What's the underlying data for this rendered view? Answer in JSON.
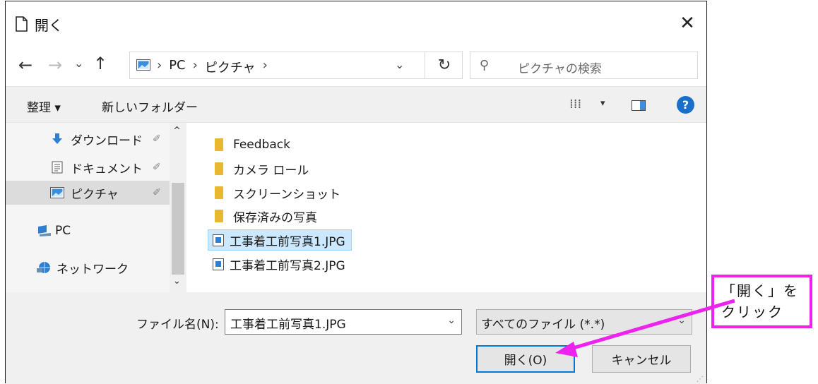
{
  "window": {
    "title": "開く",
    "close_glyph": "✕"
  },
  "navigation": {
    "back": "←",
    "forward": "→",
    "recent": "⌄",
    "up": "↑",
    "breadcrumb": [
      "PC",
      "ピクチャ"
    ],
    "separator": "›",
    "dropdown": "⌄",
    "refresh": "↻",
    "search_placeholder": "ピクチャの検索"
  },
  "toolbar": {
    "organize": "整理 ▾",
    "new_folder": "新しいフォルダー",
    "view": "⁞⁞⁞",
    "view_dropdown": "▾",
    "help": "?"
  },
  "sidebar": {
    "scroll_up": "^",
    "scroll_down": "⌄",
    "items": [
      {
        "label": "ダウンロード",
        "icon": "download-arrow-icon",
        "pinned": true
      },
      {
        "label": "ドキュメント",
        "icon": "document-icon",
        "pinned": true
      },
      {
        "label": "ピクチャ",
        "icon": "pictures-icon",
        "pinned": true,
        "selected": true
      },
      {
        "label": "PC",
        "icon": "computer-icon",
        "pinned": false
      },
      {
        "label": "ネットワーク",
        "icon": "network-icon",
        "pinned": false
      }
    ],
    "pin_glyph": "📌"
  },
  "files": [
    {
      "name": "Feedback",
      "type": "folder"
    },
    {
      "name": "カメラ ロール",
      "type": "folder"
    },
    {
      "name": "スクリーンショット",
      "type": "folder"
    },
    {
      "name": "保存済みの写真",
      "type": "folder"
    },
    {
      "name": "工事着工前写真1.JPG",
      "type": "image",
      "selected": true
    },
    {
      "name": "工事着工前写真2.JPG",
      "type": "image"
    }
  ],
  "footer": {
    "filename_label": "ファイル名(N):",
    "filename_value": "工事着工前写真1.JPG",
    "filetype_value": "すべてのファイル (*.*)",
    "open_button": "開く(O)",
    "cancel_button": "キャンセル",
    "dropdown": "⌄"
  },
  "annotation": {
    "text": "「開く」を\nクリック",
    "color": "#ee22ee"
  },
  "colors": {
    "accent": "#0078d7",
    "folder": "#e8b831",
    "selection": "#cce8ff",
    "help": "#1a6fc9"
  }
}
